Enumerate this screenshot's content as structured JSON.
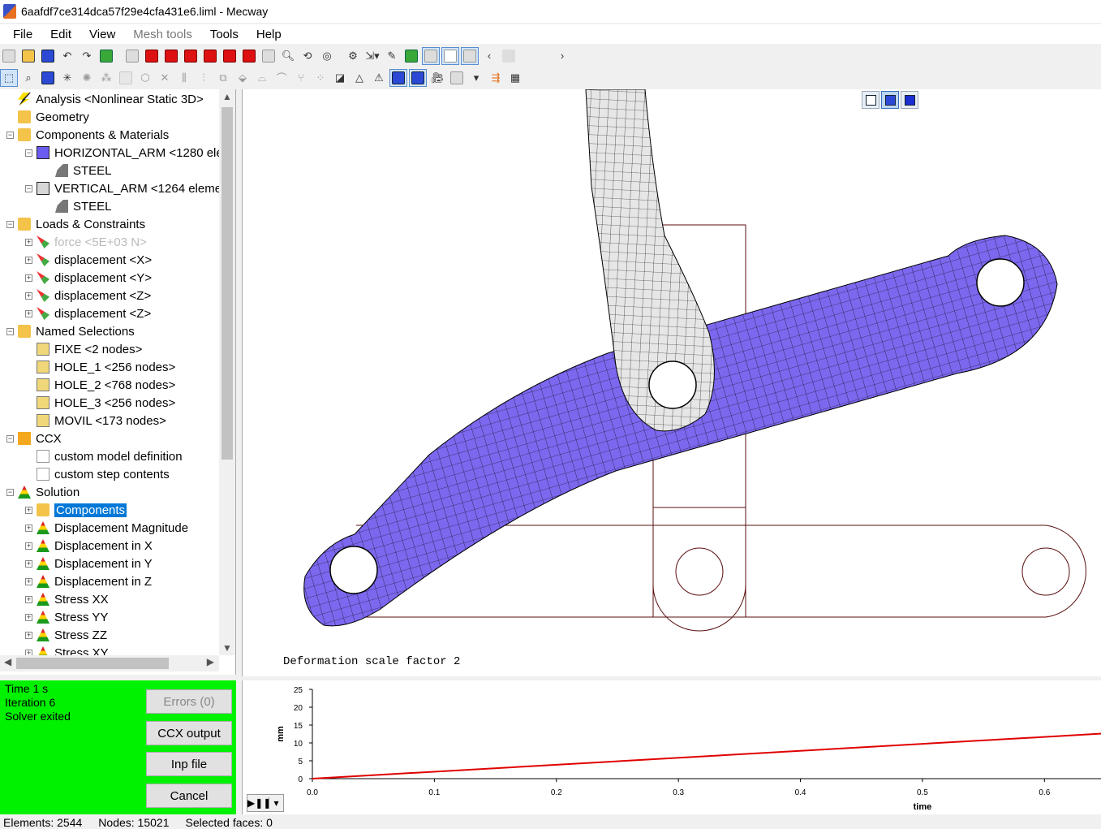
{
  "window": {
    "title": "6aafdf7ce314dca57f29e4cfa431e6.liml - Mecway"
  },
  "menu": [
    "File",
    "Edit",
    "View",
    "Mesh tools",
    "Tools",
    "Help"
  ],
  "tree": [
    {
      "label": "Analysis <Nonlinear Static 3D>",
      "icon": "analysis-icon",
      "level": 0,
      "expand": ""
    },
    {
      "label": "Geometry",
      "icon": "folder-icon",
      "level": 0,
      "expand": ""
    },
    {
      "label": "Components & Materials",
      "icon": "components-folder-icon",
      "level": 0,
      "expand": "−"
    },
    {
      "label": "HORIZONTAL_ARM <1280 ele",
      "icon": "component-icon",
      "level": 1,
      "expand": "−"
    },
    {
      "label": "STEEL",
      "icon": "material-icon",
      "level": 2,
      "expand": ""
    },
    {
      "label": "VERTICAL_ARM <1264 elemer",
      "icon": "component-gray-icon",
      "level": 1,
      "expand": "−"
    },
    {
      "label": "STEEL",
      "icon": "material-icon",
      "level": 2,
      "expand": ""
    },
    {
      "label": "Loads & Constraints",
      "icon": "loads-folder-icon",
      "level": 0,
      "expand": "−"
    },
    {
      "label": "force <5E+03 N>",
      "icon": "force-icon",
      "level": 1,
      "expand": "+",
      "disabled": true
    },
    {
      "label": "displacement <X>",
      "icon": "displacement-icon",
      "level": 1,
      "expand": "+"
    },
    {
      "label": "displacement <Y>",
      "icon": "displacement-icon",
      "level": 1,
      "expand": "+"
    },
    {
      "label": "displacement <Z>",
      "icon": "displacement-icon",
      "level": 1,
      "expand": "+"
    },
    {
      "label": "displacement <Z>",
      "icon": "displacement-icon",
      "level": 1,
      "expand": "+"
    },
    {
      "label": "Named Selections",
      "icon": "named-folder-icon",
      "level": 0,
      "expand": "−"
    },
    {
      "label": "FIXE <2 nodes>",
      "icon": "node-selection-icon",
      "level": 1,
      "expand": ""
    },
    {
      "label": "HOLE_1 <256 nodes>",
      "icon": "node-selection-icon",
      "level": 1,
      "expand": ""
    },
    {
      "label": "HOLE_2 <768 nodes>",
      "icon": "node-selection-icon",
      "level": 1,
      "expand": ""
    },
    {
      "label": "HOLE_3 <256 nodes>",
      "icon": "node-selection-icon",
      "level": 1,
      "expand": ""
    },
    {
      "label": "MOVIL <173 nodes>",
      "icon": "node-selection-icon",
      "level": 1,
      "expand": ""
    },
    {
      "label": "CCX",
      "icon": "ccx-icon",
      "level": 0,
      "expand": "−"
    },
    {
      "label": "custom model definition",
      "icon": "ccx-doc-icon",
      "level": 1,
      "expand": ""
    },
    {
      "label": "custom step contents",
      "icon": "ccx-doc-icon",
      "level": 1,
      "expand": ""
    },
    {
      "label": "Solution",
      "icon": "solution-icon",
      "level": 0,
      "expand": "−"
    },
    {
      "label": "Components",
      "icon": "components-folder-icon",
      "level": 1,
      "expand": "+",
      "selected": true
    },
    {
      "label": "Displacement Magnitude",
      "icon": "result-icon",
      "level": 1,
      "expand": "+"
    },
    {
      "label": "Displacement in X",
      "icon": "result-icon",
      "level": 1,
      "expand": "+"
    },
    {
      "label": "Displacement in Y",
      "icon": "result-icon",
      "level": 1,
      "expand": "+"
    },
    {
      "label": "Displacement in Z",
      "icon": "result-icon",
      "level": 1,
      "expand": "+"
    },
    {
      "label": "Stress XX",
      "icon": "result-icon",
      "level": 1,
      "expand": "+"
    },
    {
      "label": "Stress YY",
      "icon": "result-icon",
      "level": 1,
      "expand": "+"
    },
    {
      "label": "Stress ZZ",
      "icon": "result-icon",
      "level": 1,
      "expand": "+"
    },
    {
      "label": "Stress XY",
      "icon": "result-icon",
      "level": 1,
      "expand": "+"
    }
  ],
  "viewport": {
    "scale_text": "Deformation scale factor 2",
    "horizontal_arm_color": "#7b68ee",
    "vertical_arm_color": "#e6e6e6",
    "outline_color": "#5a0f0f"
  },
  "solver": {
    "time": "Time  1  s",
    "iteration": "Iteration  6",
    "status": "Solver exited",
    "errors_btn": "Errors (0)",
    "ccx_btn": "CCX output",
    "inp_btn": "Inp file",
    "cancel_btn": "Cancel",
    "panel_color": "#00f200"
  },
  "chart_data": {
    "type": "line",
    "ylabel": "mm",
    "xlabel": "time",
    "yticks": [
      0,
      5,
      10,
      15,
      20,
      25
    ],
    "xticks": [
      0.0,
      0.1,
      0.2,
      0.3,
      0.4,
      0.5,
      0.6
    ],
    "xlim": [
      0.0,
      0.647
    ],
    "ylim": [
      0,
      25
    ],
    "series": [
      {
        "x": [
          0.0,
          0.647
        ],
        "y": [
          0.0,
          12.6
        ],
        "color": "#e00000"
      }
    ]
  },
  "statusbar": {
    "elements": "Elements: 2544",
    "nodes": "Nodes: 15021",
    "selected": "Selected faces: 0"
  }
}
